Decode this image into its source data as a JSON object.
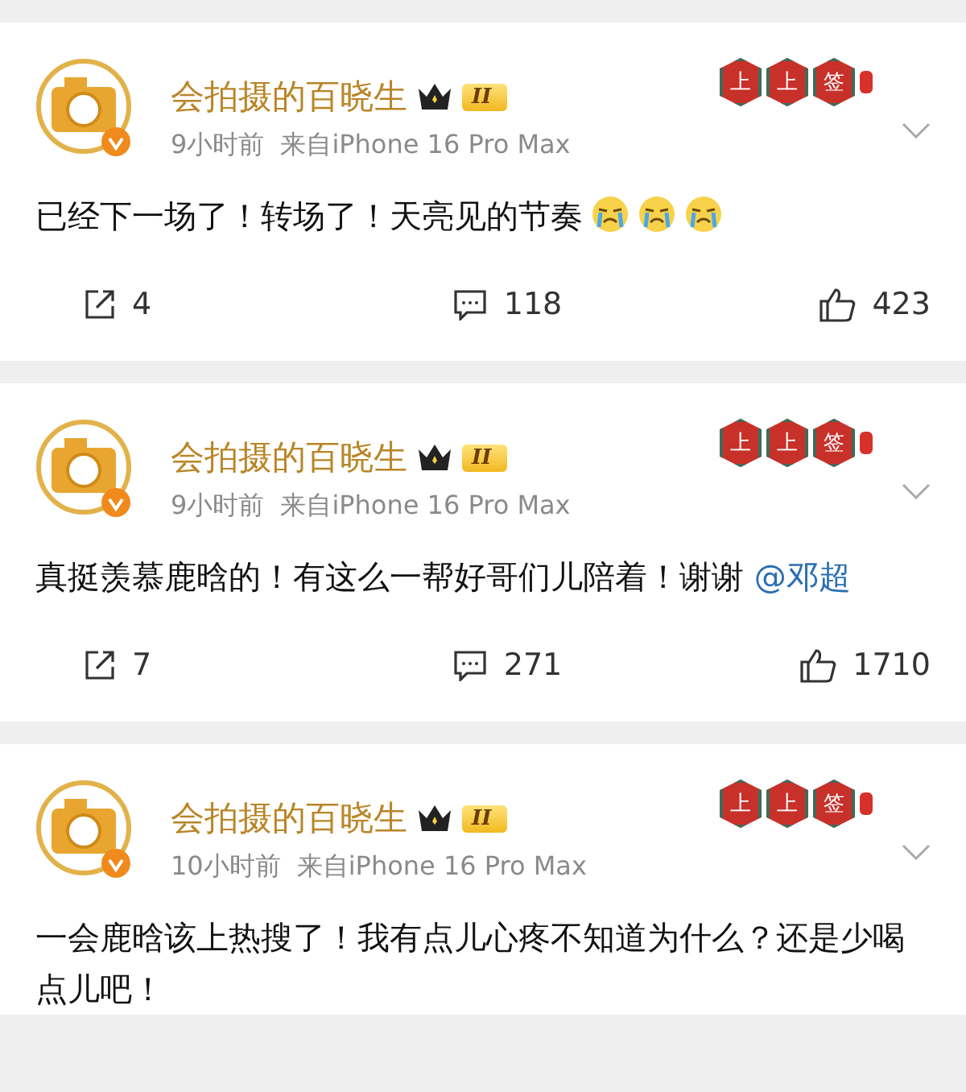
{
  "posts": [
    {
      "author": "会拍摄的百晓生",
      "level_badge": "II",
      "decor": [
        "上",
        "上",
        "签"
      ],
      "time": "9小时前",
      "source": "来自iPhone 16 Pro Max",
      "text": "已经下一场了！转场了！天亮见的节奏",
      "emojis": [
        {
          "kind": "crying"
        },
        {
          "kind": "crying"
        },
        {
          "kind": "crying"
        }
      ],
      "reposts": "4",
      "comments": "118",
      "likes": "423"
    },
    {
      "author": "会拍摄的百晓生",
      "level_badge": "II",
      "decor": [
        "上",
        "上",
        "签"
      ],
      "time": "9小时前",
      "source": "来自iPhone 16 Pro Max",
      "text": "真挺羡慕鹿晗的！有这么一帮好哥们儿陪着！谢谢 ",
      "mention": "@邓超",
      "reposts": "7",
      "comments": "271",
      "likes": "1710"
    },
    {
      "author": "会拍摄的百晓生",
      "level_badge": "II",
      "decor": [
        "上",
        "上",
        "签"
      ],
      "time": "10小时前",
      "source": "来自iPhone 16 Pro Max",
      "text": "一会鹿晗该上热搜了！我有点儿心疼不知道为什么？还是少喝点儿吧！"
    }
  ]
}
